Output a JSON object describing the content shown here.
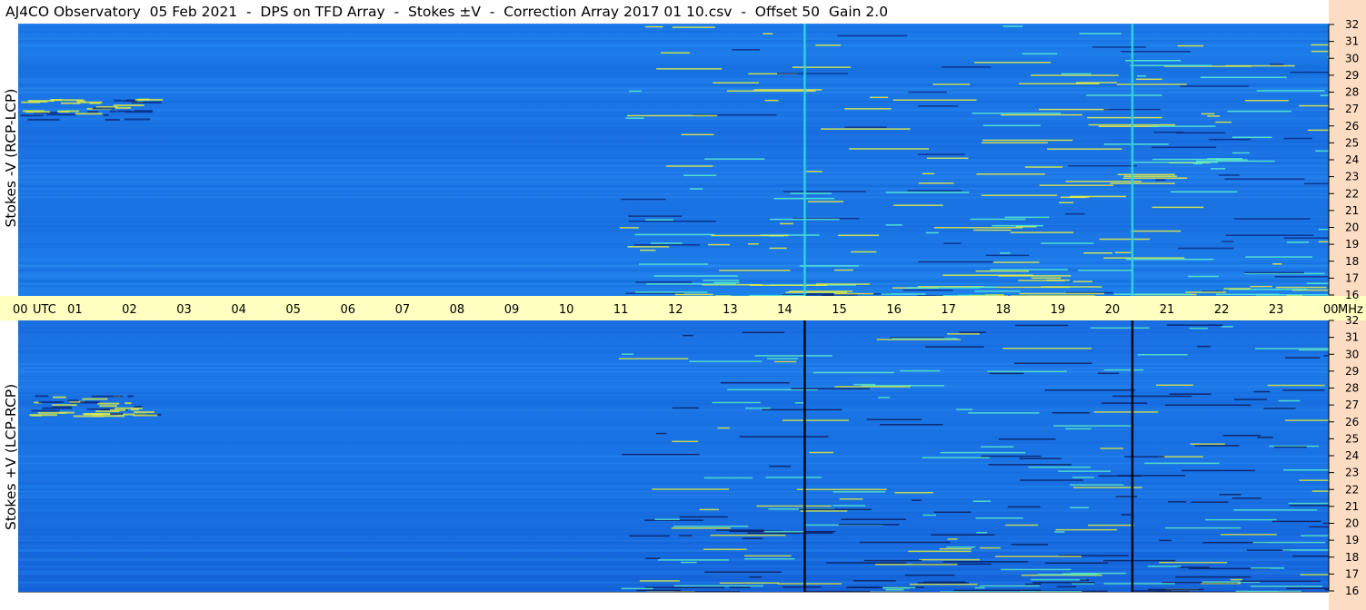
{
  "title": "AJ4CO Observatory  05 Feb 2021  -  DPS on TFD Array  -  Stokes ±V  -  Correction Array 2017 01 10.csv  -  Offset 50  Gain 2.0",
  "chart_data": [
    {
      "type": "heatmap",
      "name_label": "Stokes -V (RCP-LCP)",
      "x_ticks": [
        "00",
        "01",
        "02",
        "03",
        "04",
        "05",
        "06",
        "07",
        "08",
        "09",
        "10",
        "11",
        "12",
        "13",
        "14",
        "15",
        "16",
        "17",
        "18",
        "19",
        "20",
        "21",
        "22",
        "23",
        "00"
      ],
      "x_unit": "UTC",
      "y_ticks": [
        16,
        17,
        18,
        19,
        20,
        21,
        22,
        23,
        24,
        25,
        26,
        27,
        28,
        29,
        30,
        31,
        32
      ],
      "y_unit": "MHz",
      "ylim": [
        16,
        32
      ],
      "xlim": [
        0,
        24
      ]
    },
    {
      "type": "heatmap",
      "name_label": "Stokes +V (LCP-RCP)",
      "x_ticks": [
        "00",
        "01",
        "02",
        "03",
        "04",
        "05",
        "06",
        "07",
        "08",
        "09",
        "10",
        "11",
        "12",
        "13",
        "14",
        "15",
        "16",
        "17",
        "18",
        "19",
        "20",
        "21",
        "22",
        "23",
        "00"
      ],
      "x_unit": "UTC",
      "y_ticks": [
        16,
        17,
        18,
        19,
        20,
        21,
        22,
        23,
        24,
        25,
        26,
        27,
        28,
        29,
        30,
        31,
        32
      ],
      "y_unit": "MHz",
      "ylim": [
        16,
        32
      ],
      "xlim": [
        0,
        24
      ]
    }
  ],
  "colors": {
    "background_blue": "#1a74e6",
    "axis_band": "#ffffc0",
    "right_strip": "#fcdcc2",
    "vertical_line_top": "#33d6e0",
    "vertical_line_bottom": "#000000"
  }
}
